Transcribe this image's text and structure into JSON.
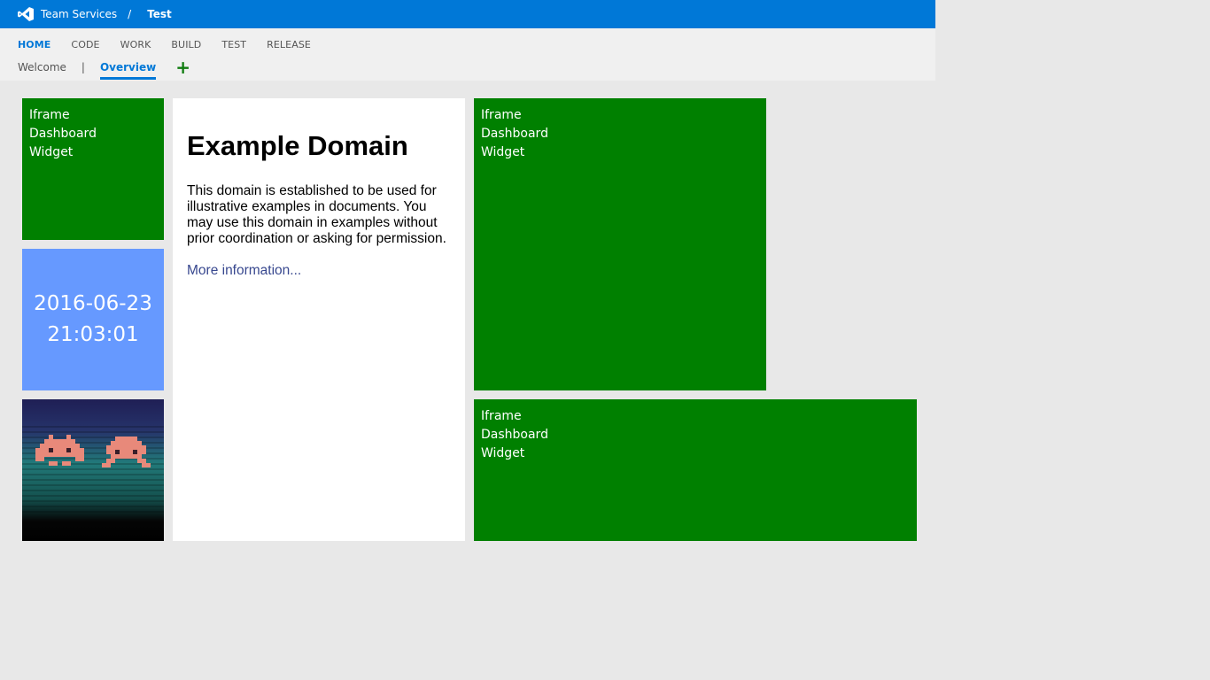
{
  "header": {
    "brand": "Team Services",
    "separator": "/",
    "project": "Test",
    "logo_icon": "visual-studio-logo-icon"
  },
  "hubs": [
    {
      "label": "HOME",
      "active": true
    },
    {
      "label": "CODE",
      "active": false
    },
    {
      "label": "WORK",
      "active": false
    },
    {
      "label": "BUILD",
      "active": false
    },
    {
      "label": "TEST",
      "active": false
    },
    {
      "label": "RELEASE",
      "active": false
    }
  ],
  "subnav": {
    "welcome": "Welcome",
    "pipe": "|",
    "overview": "Overview",
    "add_icon": "plus-icon",
    "add_symbol": "+"
  },
  "widgets": {
    "iframe_1": {
      "line1": "Iframe",
      "line2": "Dashboard",
      "line3": "Widget"
    },
    "clock": {
      "date": "2016-06-23",
      "time": "21:03:01"
    },
    "game": {
      "icon": "space-invaders-image"
    },
    "example": {
      "title": "Example Domain",
      "paragraph": "This domain is established to be used for illustrative examples in documents. You may use this domain in examples without prior coordination or asking for permission.",
      "link": "More information..."
    },
    "iframe_2": {
      "line1": "Iframe",
      "line2": "Dashboard",
      "line3": "Widget"
    },
    "iframe_3": {
      "line1": "Iframe",
      "line2": "Dashboard",
      "line3": "Widget"
    }
  },
  "colors": {
    "accent": "#0078d7",
    "widget_green": "#008000",
    "clock_blue": "#6699ff",
    "add_green": "#107c10",
    "link": "#38488f"
  }
}
